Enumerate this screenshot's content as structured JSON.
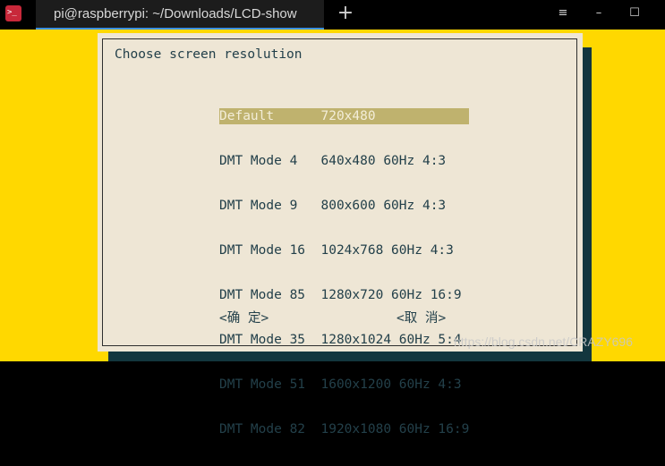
{
  "titlebar": {
    "app_icon_glyph": ">_",
    "tab_title": "pi@raspberrypi: ~/Downloads/LCD-show",
    "new_tab_glyph": "+",
    "menu_glyph": "≡",
    "minimize_glyph": "–",
    "maximize_glyph": "☐",
    "close_glyph": "✕"
  },
  "dialog": {
    "title": "Choose screen resolution",
    "items": [
      "Default      720x480",
      "DMT Mode 4   640x480 60Hz 4:3",
      "DMT Mode 9   800x600 60Hz 4:3",
      "DMT Mode 16  1024x768 60Hz 4:3",
      "DMT Mode 85  1280x720 60Hz 16:9",
      "DMT Mode 35  1280x1024 60Hz 5:4",
      "DMT Mode 51  1600x1200 60Hz 4:3",
      "DMT Mode 82  1920x1080 60Hz 16:9"
    ],
    "selected_index": 0,
    "ok_label": "<确 定>",
    "cancel_label": "<取 消>"
  },
  "watermark": "https://blog.csdn.net/CRAZY696",
  "colors": {
    "terminal_background": "#ffd800",
    "dialog_background": "#eee6d5",
    "dialog_shadow": "#13363e",
    "selection_background": "#bfb26e",
    "text": "#23404a",
    "tab_accent": "#3a8fe0"
  }
}
